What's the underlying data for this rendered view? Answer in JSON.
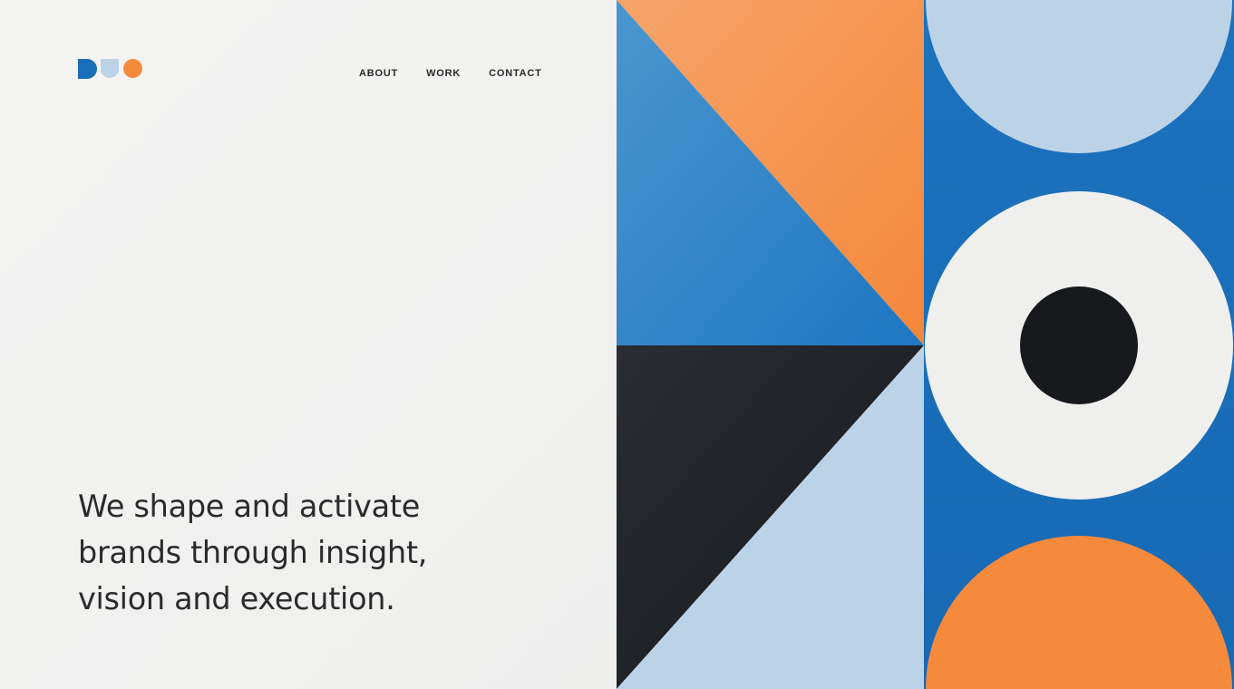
{
  "brand": {
    "name": "DUO",
    "colors": {
      "dark_blue": "#1a6db8",
      "light_blue": "#bcd3e7",
      "orange": "#f58a3d",
      "black": "#1c1f24",
      "off_white": "#f1f1f0"
    }
  },
  "nav": {
    "items": [
      {
        "label": "ABOUT"
      },
      {
        "label": "WORK"
      },
      {
        "label": "CONTACT"
      }
    ]
  },
  "hero": {
    "line1": "We shape and activate",
    "line2": "brands through insight,",
    "line3": "vision and execution."
  },
  "artwork": {
    "shapes": [
      "orange-triangle",
      "blue-triangle",
      "black-triangle",
      "light-blue-triangle",
      "light-blue-half-circle",
      "white-ring",
      "black-circle",
      "orange-half-circle"
    ]
  }
}
